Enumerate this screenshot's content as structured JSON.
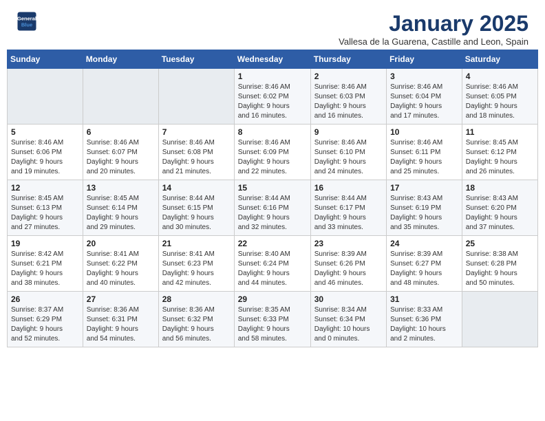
{
  "header": {
    "logo_line1": "General",
    "logo_line2": "Blue",
    "month": "January 2025",
    "location": "Vallesa de la Guarena, Castille and Leon, Spain"
  },
  "weekdays": [
    "Sunday",
    "Monday",
    "Tuesday",
    "Wednesday",
    "Thursday",
    "Friday",
    "Saturday"
  ],
  "weeks": [
    [
      {
        "day": "",
        "info": ""
      },
      {
        "day": "",
        "info": ""
      },
      {
        "day": "",
        "info": ""
      },
      {
        "day": "1",
        "info": "Sunrise: 8:46 AM\nSunset: 6:02 PM\nDaylight: 9 hours\nand 16 minutes."
      },
      {
        "day": "2",
        "info": "Sunrise: 8:46 AM\nSunset: 6:03 PM\nDaylight: 9 hours\nand 16 minutes."
      },
      {
        "day": "3",
        "info": "Sunrise: 8:46 AM\nSunset: 6:04 PM\nDaylight: 9 hours\nand 17 minutes."
      },
      {
        "day": "4",
        "info": "Sunrise: 8:46 AM\nSunset: 6:05 PM\nDaylight: 9 hours\nand 18 minutes."
      }
    ],
    [
      {
        "day": "5",
        "info": "Sunrise: 8:46 AM\nSunset: 6:06 PM\nDaylight: 9 hours\nand 19 minutes."
      },
      {
        "day": "6",
        "info": "Sunrise: 8:46 AM\nSunset: 6:07 PM\nDaylight: 9 hours\nand 20 minutes."
      },
      {
        "day": "7",
        "info": "Sunrise: 8:46 AM\nSunset: 6:08 PM\nDaylight: 9 hours\nand 21 minutes."
      },
      {
        "day": "8",
        "info": "Sunrise: 8:46 AM\nSunset: 6:09 PM\nDaylight: 9 hours\nand 22 minutes."
      },
      {
        "day": "9",
        "info": "Sunrise: 8:46 AM\nSunset: 6:10 PM\nDaylight: 9 hours\nand 24 minutes."
      },
      {
        "day": "10",
        "info": "Sunrise: 8:46 AM\nSunset: 6:11 PM\nDaylight: 9 hours\nand 25 minutes."
      },
      {
        "day": "11",
        "info": "Sunrise: 8:45 AM\nSunset: 6:12 PM\nDaylight: 9 hours\nand 26 minutes."
      }
    ],
    [
      {
        "day": "12",
        "info": "Sunrise: 8:45 AM\nSunset: 6:13 PM\nDaylight: 9 hours\nand 27 minutes."
      },
      {
        "day": "13",
        "info": "Sunrise: 8:45 AM\nSunset: 6:14 PM\nDaylight: 9 hours\nand 29 minutes."
      },
      {
        "day": "14",
        "info": "Sunrise: 8:44 AM\nSunset: 6:15 PM\nDaylight: 9 hours\nand 30 minutes."
      },
      {
        "day": "15",
        "info": "Sunrise: 8:44 AM\nSunset: 6:16 PM\nDaylight: 9 hours\nand 32 minutes."
      },
      {
        "day": "16",
        "info": "Sunrise: 8:44 AM\nSunset: 6:17 PM\nDaylight: 9 hours\nand 33 minutes."
      },
      {
        "day": "17",
        "info": "Sunrise: 8:43 AM\nSunset: 6:19 PM\nDaylight: 9 hours\nand 35 minutes."
      },
      {
        "day": "18",
        "info": "Sunrise: 8:43 AM\nSunset: 6:20 PM\nDaylight: 9 hours\nand 37 minutes."
      }
    ],
    [
      {
        "day": "19",
        "info": "Sunrise: 8:42 AM\nSunset: 6:21 PM\nDaylight: 9 hours\nand 38 minutes."
      },
      {
        "day": "20",
        "info": "Sunrise: 8:41 AM\nSunset: 6:22 PM\nDaylight: 9 hours\nand 40 minutes."
      },
      {
        "day": "21",
        "info": "Sunrise: 8:41 AM\nSunset: 6:23 PM\nDaylight: 9 hours\nand 42 minutes."
      },
      {
        "day": "22",
        "info": "Sunrise: 8:40 AM\nSunset: 6:24 PM\nDaylight: 9 hours\nand 44 minutes."
      },
      {
        "day": "23",
        "info": "Sunrise: 8:39 AM\nSunset: 6:26 PM\nDaylight: 9 hours\nand 46 minutes."
      },
      {
        "day": "24",
        "info": "Sunrise: 8:39 AM\nSunset: 6:27 PM\nDaylight: 9 hours\nand 48 minutes."
      },
      {
        "day": "25",
        "info": "Sunrise: 8:38 AM\nSunset: 6:28 PM\nDaylight: 9 hours\nand 50 minutes."
      }
    ],
    [
      {
        "day": "26",
        "info": "Sunrise: 8:37 AM\nSunset: 6:29 PM\nDaylight: 9 hours\nand 52 minutes."
      },
      {
        "day": "27",
        "info": "Sunrise: 8:36 AM\nSunset: 6:31 PM\nDaylight: 9 hours\nand 54 minutes."
      },
      {
        "day": "28",
        "info": "Sunrise: 8:36 AM\nSunset: 6:32 PM\nDaylight: 9 hours\nand 56 minutes."
      },
      {
        "day": "29",
        "info": "Sunrise: 8:35 AM\nSunset: 6:33 PM\nDaylight: 9 hours\nand 58 minutes."
      },
      {
        "day": "30",
        "info": "Sunrise: 8:34 AM\nSunset: 6:34 PM\nDaylight: 10 hours\nand 0 minutes."
      },
      {
        "day": "31",
        "info": "Sunrise: 8:33 AM\nSunset: 6:36 PM\nDaylight: 10 hours\nand 2 minutes."
      },
      {
        "day": "",
        "info": ""
      }
    ]
  ]
}
